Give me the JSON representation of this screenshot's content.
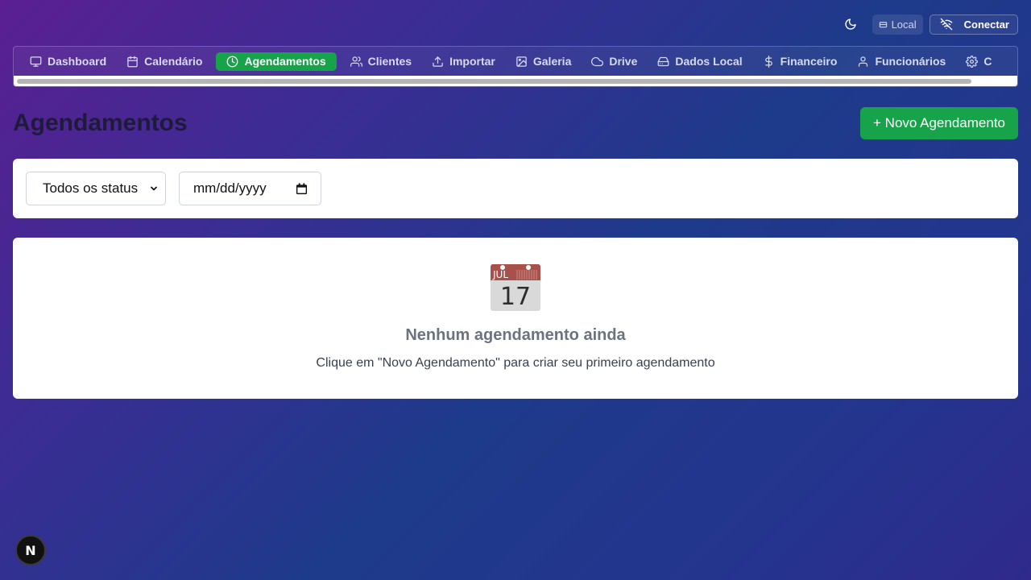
{
  "topbar": {
    "local_label": "Local",
    "connect_label": "Conectar"
  },
  "nav": {
    "items": [
      {
        "label": "Dashboard",
        "icon": "monitor-icon"
      },
      {
        "label": "Calendário",
        "icon": "calendar-icon"
      },
      {
        "label": "Agendamentos",
        "icon": "clock-icon",
        "active": true
      },
      {
        "label": "Clientes",
        "icon": "users-icon"
      },
      {
        "label": "Importar",
        "icon": "upload-icon"
      },
      {
        "label": "Galeria",
        "icon": "image-icon"
      },
      {
        "label": "Drive",
        "icon": "cloud-icon"
      },
      {
        "label": "Dados Local",
        "icon": "hard-drive-icon"
      },
      {
        "label": "Financeiro",
        "icon": "dollar-icon"
      },
      {
        "label": "Funcionários",
        "icon": "users-icon"
      },
      {
        "label": "C",
        "icon": "gear-icon"
      }
    ]
  },
  "header": {
    "title": "Agendamentos",
    "new_button": "+ Novo Agendamento"
  },
  "filters": {
    "status_selected": "Todos os status",
    "date_placeholder": "mm/dd/yyyy"
  },
  "empty_state": {
    "icon_month": "JUL",
    "icon_day": "17",
    "title": "Nenhum agendamento ainda",
    "subtitle": "Clique em \"Novo Agendamento\" para criar seu primeiro agendamento"
  },
  "dev_badge": {
    "label": "N"
  },
  "colors": {
    "accent_green": "#16a34a",
    "card_bg": "#ffffff",
    "title_text": "#1e1b3a"
  }
}
